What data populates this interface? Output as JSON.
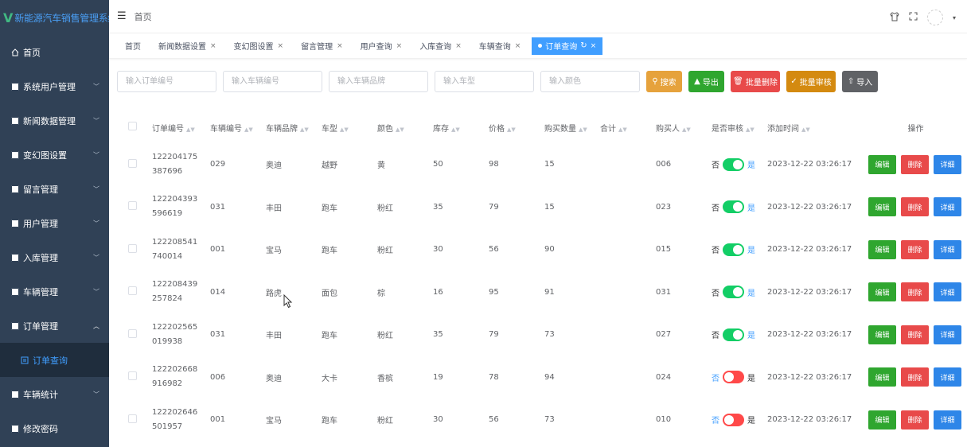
{
  "app": {
    "title": "新能源汽车销售管理系统"
  },
  "sidebar": {
    "items": [
      {
        "label": "首页",
        "icon": "home-icon",
        "expandable": false
      },
      {
        "label": "系统用户管理",
        "icon": "grid-icon",
        "expandable": true
      },
      {
        "label": "新闻数据管理",
        "icon": "grid-icon",
        "expandable": true
      },
      {
        "label": "变幻图设置",
        "icon": "grid-icon",
        "expandable": true
      },
      {
        "label": "留言管理",
        "icon": "grid-icon",
        "expandable": true
      },
      {
        "label": "用户管理",
        "icon": "grid-icon",
        "expandable": true
      },
      {
        "label": "入库管理",
        "icon": "grid-icon",
        "expandable": true
      },
      {
        "label": "车辆管理",
        "icon": "grid-icon",
        "expandable": true
      },
      {
        "label": "订单管理",
        "icon": "grid-icon",
        "expandable": true,
        "open": true
      },
      {
        "label": "订单查询",
        "icon": "list-icon",
        "sub": true
      },
      {
        "label": "车辆统计",
        "icon": "grid-icon",
        "expandable": true
      },
      {
        "label": "修改密码",
        "icon": "grid-icon",
        "expandable": false
      }
    ]
  },
  "header": {
    "breadcrumb": "首页"
  },
  "tags": [
    {
      "label": "首页",
      "closable": false
    },
    {
      "label": "新闻数据设置",
      "closable": true
    },
    {
      "label": "变幻图设置",
      "closable": true
    },
    {
      "label": "留言管理",
      "closable": true
    },
    {
      "label": "用户查询",
      "closable": true
    },
    {
      "label": "入库查询",
      "closable": true
    },
    {
      "label": "车辆查询",
      "closable": true
    },
    {
      "label": "订单查询",
      "closable": true,
      "active": true
    }
  ],
  "search": {
    "order_no_placeholder": "输入订单编号",
    "car_no_placeholder": "输入车辆编号",
    "brand_placeholder": "输入车辆品牌",
    "model_placeholder": "输入车型",
    "color_placeholder": "输入颜色",
    "search_label": "搜索",
    "export_label": "导出",
    "batch_delete_label": "批量删除",
    "batch_audit_label": "批量审核",
    "import_label": "导入"
  },
  "table": {
    "columns": [
      "订单编号",
      "车辆编号",
      "车辆品牌",
      "车型",
      "颜色",
      "库存",
      "价格",
      "购买数量",
      "合计",
      "购买人",
      "是否审核",
      "添加时间",
      "操作"
    ],
    "switch_no": "否",
    "switch_yes": "是",
    "edit_label": "编辑",
    "delete_label": "删除",
    "detail_label": "详细",
    "rows": [
      {
        "order_no": "122204175387696",
        "car_no": "029",
        "brand": "奥迪",
        "model": "越野",
        "color": "黄",
        "stock": "50",
        "price": "98",
        "qty": "15",
        "total": "",
        "buyer": "006",
        "audited": true,
        "time": "2023-12-22 03:26:17"
      },
      {
        "order_no": "122204393596619",
        "car_no": "031",
        "brand": "丰田",
        "model": "跑车",
        "color": "粉红",
        "stock": "35",
        "price": "79",
        "qty": "15",
        "total": "",
        "buyer": "023",
        "audited": true,
        "time": "2023-12-22 03:26:17"
      },
      {
        "order_no": "122208541740014",
        "car_no": "001",
        "brand": "宝马",
        "model": "跑车",
        "color": "粉红",
        "stock": "30",
        "price": "56",
        "qty": "90",
        "total": "",
        "buyer": "015",
        "audited": true,
        "time": "2023-12-22 03:26:17"
      },
      {
        "order_no": "122208439257824",
        "car_no": "014",
        "brand": "路虎",
        "model": "面包",
        "color": "棕",
        "stock": "16",
        "price": "95",
        "qty": "91",
        "total": "",
        "buyer": "031",
        "audited": true,
        "time": "2023-12-22 03:26:17"
      },
      {
        "order_no": "122202565019938",
        "car_no": "031",
        "brand": "丰田",
        "model": "跑车",
        "color": "粉红",
        "stock": "35",
        "price": "79",
        "qty": "73",
        "total": "",
        "buyer": "027",
        "audited": true,
        "time": "2023-12-22 03:26:17"
      },
      {
        "order_no": "122202668916982",
        "car_no": "006",
        "brand": "奥迪",
        "model": "大卡",
        "color": "香槟",
        "stock": "19",
        "price": "78",
        "qty": "94",
        "total": "",
        "buyer": "024",
        "audited": false,
        "time": "2023-12-22 03:26:17"
      },
      {
        "order_no": "122202646501957",
        "car_no": "001",
        "brand": "宝马",
        "model": "跑车",
        "color": "粉红",
        "stock": "30",
        "price": "56",
        "qty": "73",
        "total": "",
        "buyer": "010",
        "audited": false,
        "time": "2023-12-22 03:26:17"
      }
    ]
  },
  "colors": {
    "sidebar_bg": "#304156",
    "accent": "#409eff",
    "switch_on": "#13ce66",
    "switch_off": "#ff4949"
  }
}
